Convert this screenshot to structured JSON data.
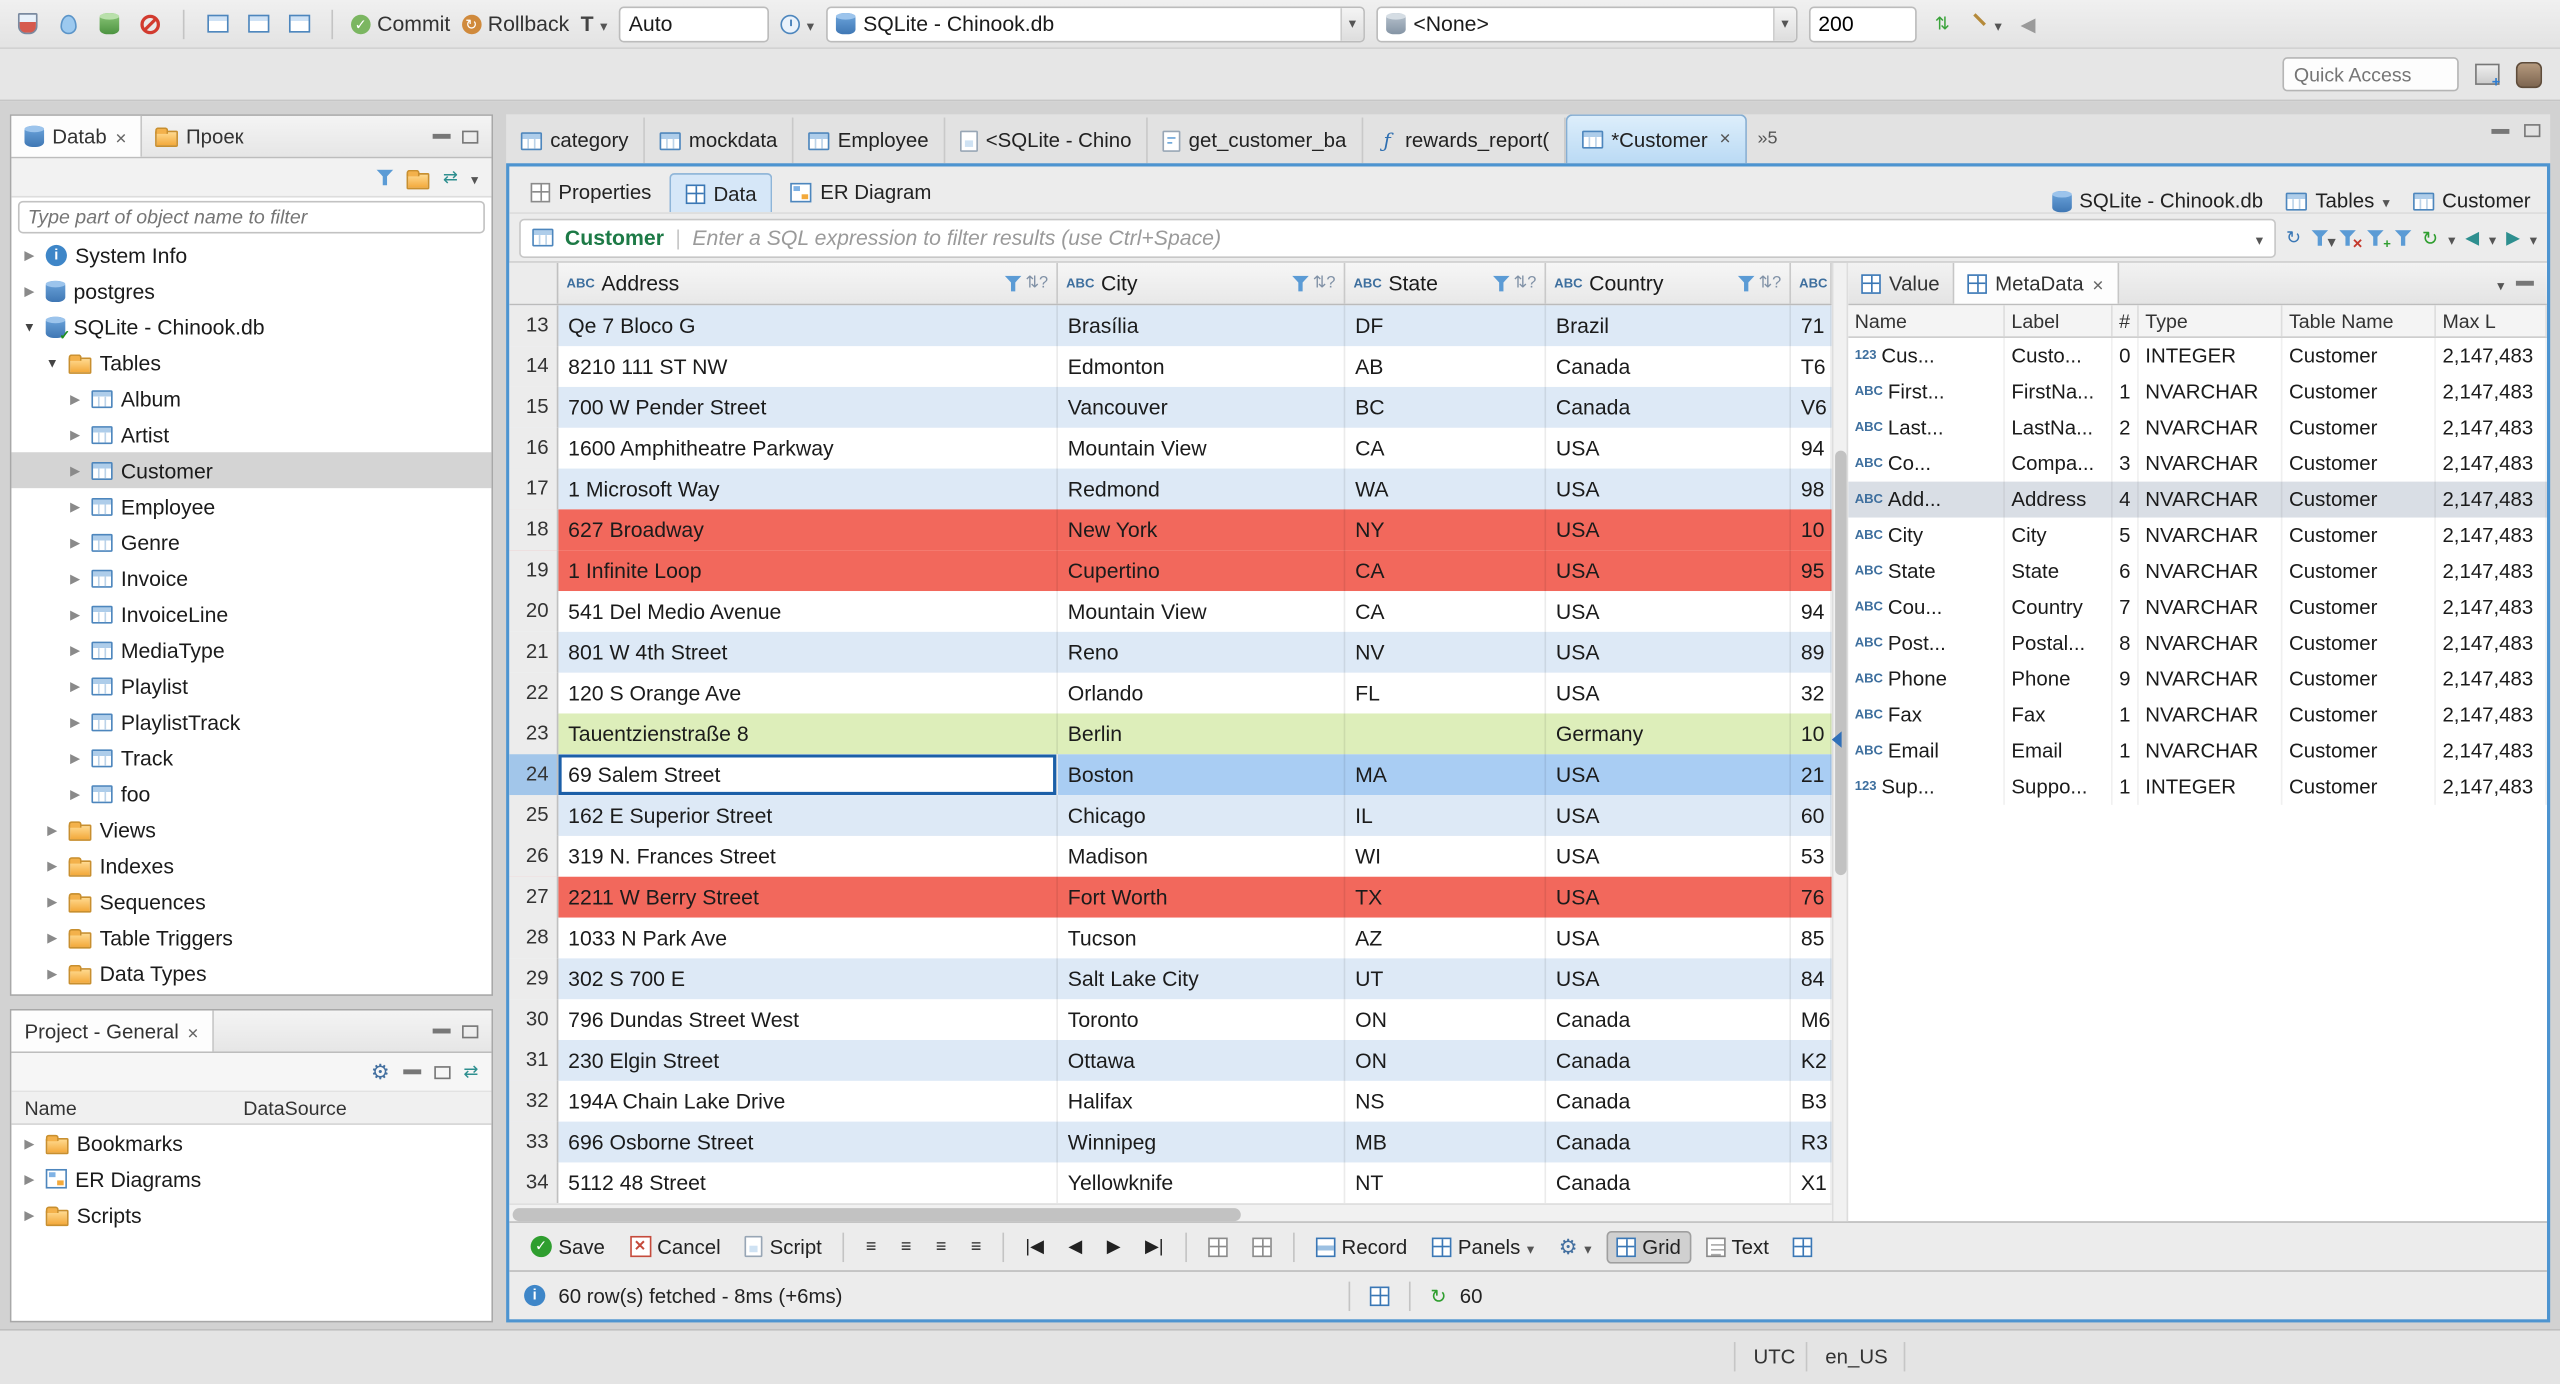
{
  "icons": {
    "chevron_down": "▾",
    "collapsed": "▶",
    "expanded": "▼",
    "close": "✕",
    "check": "✓",
    "sort_indicator": "⇅?",
    "refresh": "↻",
    "gear": "⚙",
    "func": "ƒ",
    "nav_first": "|◀",
    "nav_prev": "◀",
    "nav_next": "▶",
    "nav_last": "▶|",
    "back": "◀",
    "forward": "▶",
    "overflow_tabs": "»5"
  },
  "toolbar": {
    "commit_label": "Commit",
    "rollback_label": "Rollback",
    "txn_mode": "Auto",
    "db_selector": "SQLite - Chinook.db",
    "schema_selector": "<None>",
    "fetch_size": "200",
    "quick_access_placeholder": "Quick Access"
  },
  "navigator": {
    "tab_db": "Datab",
    "tab_project": "Проек",
    "filter_placeholder": "Type part of object name to filter",
    "tree": [
      {
        "label": "System Info",
        "icon": "info",
        "depth": 0,
        "state": "collapsed"
      },
      {
        "label": "postgres",
        "icon": "database",
        "depth": 0,
        "state": "collapsed"
      },
      {
        "label": "SQLite - Chinook.db",
        "icon": "database-connected",
        "depth": 0,
        "state": "expanded"
      },
      {
        "label": "Tables",
        "icon": "folder",
        "depth": 1,
        "state": "expanded"
      },
      {
        "label": "Album",
        "icon": "table",
        "depth": 2,
        "state": "collapsed"
      },
      {
        "label": "Artist",
        "icon": "table",
        "depth": 2,
        "state": "collapsed"
      },
      {
        "label": "Customer",
        "icon": "table",
        "depth": 2,
        "state": "collapsed",
        "selected": true
      },
      {
        "label": "Employee",
        "icon": "table",
        "depth": 2,
        "state": "collapsed"
      },
      {
        "label": "Genre",
        "icon": "table",
        "depth": 2,
        "state": "collapsed"
      },
      {
        "label": "Invoice",
        "icon": "table",
        "depth": 2,
        "state": "collapsed"
      },
      {
        "label": "InvoiceLine",
        "icon": "table",
        "depth": 2,
        "state": "collapsed"
      },
      {
        "label": "MediaType",
        "icon": "table",
        "depth": 2,
        "state": "collapsed"
      },
      {
        "label": "Playlist",
        "icon": "table",
        "depth": 2,
        "state": "collapsed"
      },
      {
        "label": "PlaylistTrack",
        "icon": "table",
        "depth": 2,
        "state": "collapsed"
      },
      {
        "label": "Track",
        "icon": "table",
        "depth": 2,
        "state": "collapsed"
      },
      {
        "label": "foo",
        "icon": "table",
        "depth": 2,
        "state": "collapsed"
      },
      {
        "label": "Views",
        "icon": "folder",
        "depth": 1,
        "state": "collapsed"
      },
      {
        "label": "Indexes",
        "icon": "folder",
        "depth": 1,
        "state": "collapsed"
      },
      {
        "label": "Sequences",
        "icon": "folder",
        "depth": 1,
        "state": "collapsed"
      },
      {
        "label": "Table Triggers",
        "icon": "folder",
        "depth": 1,
        "state": "collapsed"
      },
      {
        "label": "Data Types",
        "icon": "folder",
        "depth": 1,
        "state": "collapsed"
      }
    ]
  },
  "project_panel": {
    "title": "Project - General",
    "columns": {
      "name": "Name",
      "datasource": "DataSource"
    },
    "items": [
      {
        "label": "Bookmarks",
        "icon": "folder"
      },
      {
        "label": "ER Diagrams",
        "icon": "diagram"
      },
      {
        "label": "Scripts",
        "icon": "folder"
      }
    ]
  },
  "editor_tabs": [
    {
      "label": "category",
      "icon": "table"
    },
    {
      "label": "mockdata",
      "icon": "table"
    },
    {
      "label": "Employee",
      "icon": "table"
    },
    {
      "label": "<SQLite - Chino",
      "icon": "sql"
    },
    {
      "label": "get_customer_ba",
      "icon": "script"
    },
    {
      "label": "rewards_report(",
      "icon": "function"
    },
    {
      "label": "*Customer",
      "icon": "table",
      "active": true
    }
  ],
  "tab_overflow": "»5",
  "subtabs": {
    "properties": "Properties",
    "data": "Data",
    "er": "ER Diagram",
    "context_db": "SQLite - Chinook.db",
    "context_container": "Tables",
    "context_entity": "Customer"
  },
  "filter_bar": {
    "table": "Customer",
    "placeholder": "Enter a SQL expression to filter results (use Ctrl+Space)"
  },
  "grid": {
    "columns": [
      {
        "key": "address",
        "label": "Address",
        "type": "ABC",
        "filterable": true
      },
      {
        "key": "city",
        "label": "City",
        "type": "ABC",
        "filterable": true
      },
      {
        "key": "state",
        "label": "State",
        "type": "ABC",
        "filterable": true
      },
      {
        "key": "country",
        "label": "Country",
        "type": "ABC",
        "filterable": true
      },
      {
        "key": "postal",
        "label": "",
        "type": "ABC",
        "filterable": false
      }
    ],
    "rows": [
      {
        "num": 13,
        "address": "Qe 7 Bloco G",
        "city": "Brasília",
        "state": "DF",
        "country": "Brazil",
        "postal": "71",
        "highlight": ""
      },
      {
        "num": 14,
        "address": "8210 111 ST NW",
        "city": "Edmonton",
        "state": "AB",
        "country": "Canada",
        "postal": "T6",
        "highlight": ""
      },
      {
        "num": 15,
        "address": "700 W Pender Street",
        "city": "Vancouver",
        "state": "BC",
        "country": "Canada",
        "postal": "V6",
        "highlight": ""
      },
      {
        "num": 16,
        "address": "1600 Amphitheatre Parkway",
        "city": "Mountain View",
        "state": "CA",
        "country": "USA",
        "postal": "94",
        "highlight": ""
      },
      {
        "num": 17,
        "address": "1 Microsoft Way",
        "city": "Redmond",
        "state": "WA",
        "country": "USA",
        "postal": "98",
        "highlight": ""
      },
      {
        "num": 18,
        "address": "627 Broadway",
        "city": "New York",
        "state": "NY",
        "country": "USA",
        "postal": "10",
        "highlight": "red"
      },
      {
        "num": 19,
        "address": "1 Infinite Loop",
        "city": "Cupertino",
        "state": "CA",
        "country": "USA",
        "postal": "95",
        "highlight": "red"
      },
      {
        "num": 20,
        "address": "541 Del Medio Avenue",
        "city": "Mountain View",
        "state": "CA",
        "country": "USA",
        "postal": "94",
        "highlight": ""
      },
      {
        "num": 21,
        "address": "801 W 4th Street",
        "city": "Reno",
        "state": "NV",
        "country": "USA",
        "postal": "89",
        "highlight": ""
      },
      {
        "num": 22,
        "address": "120 S Orange Ave",
        "city": "Orlando",
        "state": "FL",
        "country": "USA",
        "postal": "32",
        "highlight": ""
      },
      {
        "num": 23,
        "address": "Tauentzienstraße 8",
        "city": "Berlin",
        "state": "",
        "country": "Germany",
        "postal": "10",
        "highlight": "green"
      },
      {
        "num": 24,
        "address": "69 Salem Street",
        "city": "Boston",
        "state": "MA",
        "country": "USA",
        "postal": "21",
        "highlight": "selected"
      },
      {
        "num": 25,
        "address": "162 E Superior Street",
        "city": "Chicago",
        "state": "IL",
        "country": "USA",
        "postal": "60",
        "highlight": ""
      },
      {
        "num": 26,
        "address": "319 N. Frances Street",
        "city": "Madison",
        "state": "WI",
        "country": "USA",
        "postal": "53",
        "highlight": ""
      },
      {
        "num": 27,
        "address": "2211 W Berry Street",
        "city": "Fort Worth",
        "state": "TX",
        "country": "USA",
        "postal": "76",
        "highlight": "red"
      },
      {
        "num": 28,
        "address": "1033 N Park Ave",
        "city": "Tucson",
        "state": "AZ",
        "country": "USA",
        "postal": "85",
        "highlight": ""
      },
      {
        "num": 29,
        "address": "302 S 700 E",
        "city": "Salt Lake City",
        "state": "UT",
        "country": "USA",
        "postal": "84",
        "highlight": ""
      },
      {
        "num": 30,
        "address": "796 Dundas Street West",
        "city": "Toronto",
        "state": "ON",
        "country": "Canada",
        "postal": "M6",
        "highlight": ""
      },
      {
        "num": 31,
        "address": "230 Elgin Street",
        "city": "Ottawa",
        "state": "ON",
        "country": "Canada",
        "postal": "K2",
        "highlight": ""
      },
      {
        "num": 32,
        "address": "194A Chain Lake Drive",
        "city": "Halifax",
        "state": "NS",
        "country": "Canada",
        "postal": "B3",
        "highlight": ""
      },
      {
        "num": 33,
        "address": "696 Osborne Street",
        "city": "Winnipeg",
        "state": "MB",
        "country": "Canada",
        "postal": "R3",
        "highlight": ""
      },
      {
        "num": 34,
        "address": "5112 48 Street",
        "city": "Yellowknife",
        "state": "NT",
        "country": "Canada",
        "postal": "X1",
        "highlight": ""
      }
    ]
  },
  "meta_panel": {
    "tab_value": "Value",
    "tab_metadata": "MetaData",
    "columns": [
      "Name",
      "Label",
      "#",
      "Type",
      "Table Name",
      "Max L"
    ],
    "rows": [
      {
        "type_icon": "123",
        "name": "Cus...",
        "label": "Custo...",
        "ord": "0",
        "type": "INTEGER",
        "table": "Customer",
        "max": "2,147,483"
      },
      {
        "type_icon": "ABC",
        "name": "First...",
        "label": "FirstNa...",
        "ord": "1",
        "type": "NVARCHAR",
        "table": "Customer",
        "max": "2,147,483"
      },
      {
        "type_icon": "ABC",
        "name": "Last...",
        "label": "LastNa...",
        "ord": "2",
        "type": "NVARCHAR",
        "table": "Customer",
        "max": "2,147,483"
      },
      {
        "type_icon": "ABC",
        "name": "Co...",
        "label": "Compa...",
        "ord": "3",
        "type": "NVARCHAR",
        "table": "Customer",
        "max": "2,147,483"
      },
      {
        "type_icon": "ABC",
        "name": "Add...",
        "label": "Address",
        "ord": "4",
        "type": "NVARCHAR",
        "table": "Customer",
        "max": "2,147,483",
        "selected": true
      },
      {
        "type_icon": "ABC",
        "name": "City",
        "label": "City",
        "ord": "5",
        "type": "NVARCHAR",
        "table": "Customer",
        "max": "2,147,483"
      },
      {
        "type_icon": "ABC",
        "name": "State",
        "label": "State",
        "ord": "6",
        "type": "NVARCHAR",
        "table": "Customer",
        "max": "2,147,483"
      },
      {
        "type_icon": "ABC",
        "name": "Cou...",
        "label": "Country",
        "ord": "7",
        "type": "NVARCHAR",
        "table": "Customer",
        "max": "2,147,483"
      },
      {
        "type_icon": "ABC",
        "name": "Post...",
        "label": "Postal...",
        "ord": "8",
        "type": "NVARCHAR",
        "table": "Customer",
        "max": "2,147,483"
      },
      {
        "type_icon": "ABC",
        "name": "Phone",
        "label": "Phone",
        "ord": "9",
        "type": "NVARCHAR",
        "table": "Customer",
        "max": "2,147,483"
      },
      {
        "type_icon": "ABC",
        "name": "Fax",
        "label": "Fax",
        "ord": "1",
        "type": "NVARCHAR",
        "table": "Customer",
        "max": "2,147,483"
      },
      {
        "type_icon": "ABC",
        "name": "Email",
        "label": "Email",
        "ord": "1",
        "type": "NVARCHAR",
        "table": "Customer",
        "max": "2,147,483"
      },
      {
        "type_icon": "123",
        "name": "Sup...",
        "label": "Suppo...",
        "ord": "1",
        "type": "INTEGER",
        "table": "Customer",
        "max": "2,147,483"
      }
    ]
  },
  "result_toolbar": {
    "save": "Save",
    "cancel": "Cancel",
    "script": "Script",
    "record": "Record",
    "panels": "Panels",
    "grid": "Grid",
    "text": "Text"
  },
  "status": {
    "message": "60 row(s) fetched - 8ms (+6ms)",
    "fetch_count": "60"
  },
  "statusbar": {
    "timezone": "UTC",
    "locale": "en_US"
  },
  "colors": {
    "accent": "#3e7fc1",
    "row_red": "#f2685c",
    "row_green": "#ddeeba",
    "row_selected": "#a9cdf3",
    "editor_focus_border": "#4d94d0"
  }
}
